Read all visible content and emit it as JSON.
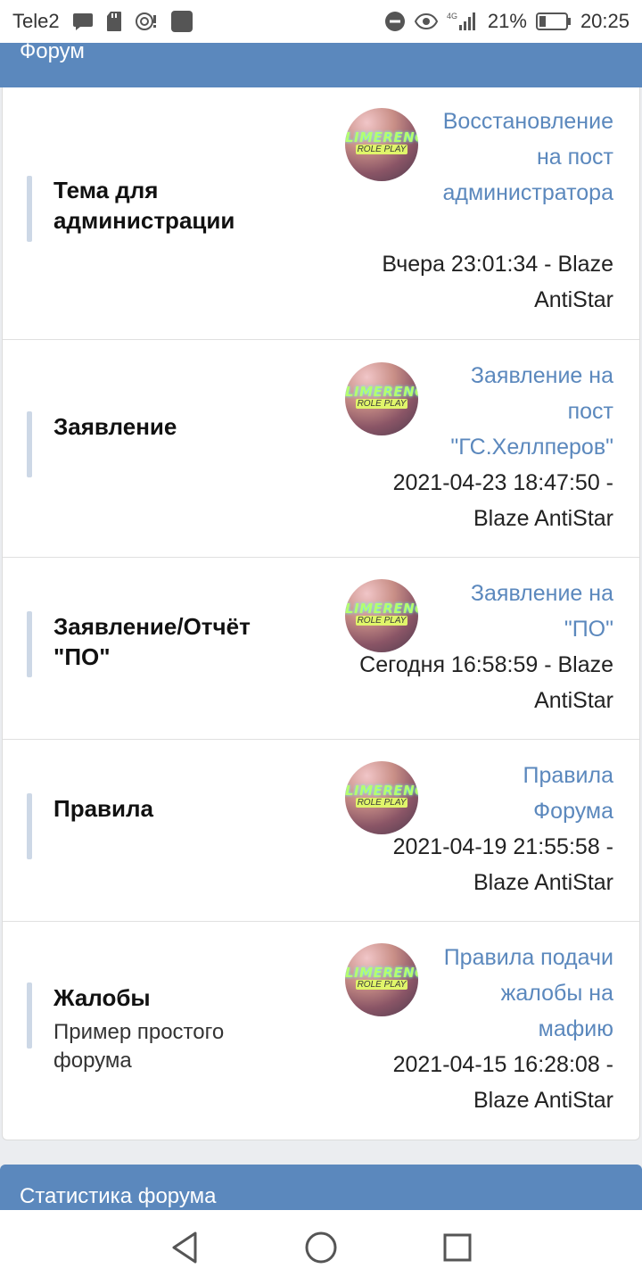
{
  "status_bar": {
    "carrier": "Tele2",
    "battery_percent": "21%",
    "time": "20:25",
    "network": "4G"
  },
  "forum_header": {
    "title": "Форум"
  },
  "forums": [
    {
      "title": "Тема для администрации",
      "description": "",
      "last_post_title": "Восстановление на пост администратора",
      "last_post_meta": "Вчера 23:01:34 - Blaze AntiStar"
    },
    {
      "title": "Заявление",
      "description": "",
      "last_post_title": "Заявление на пост \"ГС.Хеллперов\"",
      "last_post_meta": "2021-04-23 18:47:50 - Blaze AntiStar"
    },
    {
      "title": "Заявление/Отчёт \"ПО\"",
      "description": "",
      "last_post_title": "Заявление на \"ПО\"",
      "last_post_meta": "Сегодня 16:58:59 - Blaze AntiStar"
    },
    {
      "title": "Правила",
      "description": "",
      "last_post_title": "Правила Форума",
      "last_post_meta": "2021-04-19 21:55:58 - Blaze AntiStar"
    },
    {
      "title": "Жалобы",
      "description": "Пример простого форума",
      "last_post_title": "Правила подачи жалобы на мафию",
      "last_post_meta": "2021-04-15 16:28:08 - Blaze AntiStar"
    }
  ],
  "avatar_logo": {
    "line1": "LIMERENCE",
    "line2": "ROLE PLAY"
  },
  "stats_header": {
    "title": "Статистика форума"
  },
  "colors": {
    "accent": "#5b88bd",
    "row_bar": "#cdd8e6"
  }
}
